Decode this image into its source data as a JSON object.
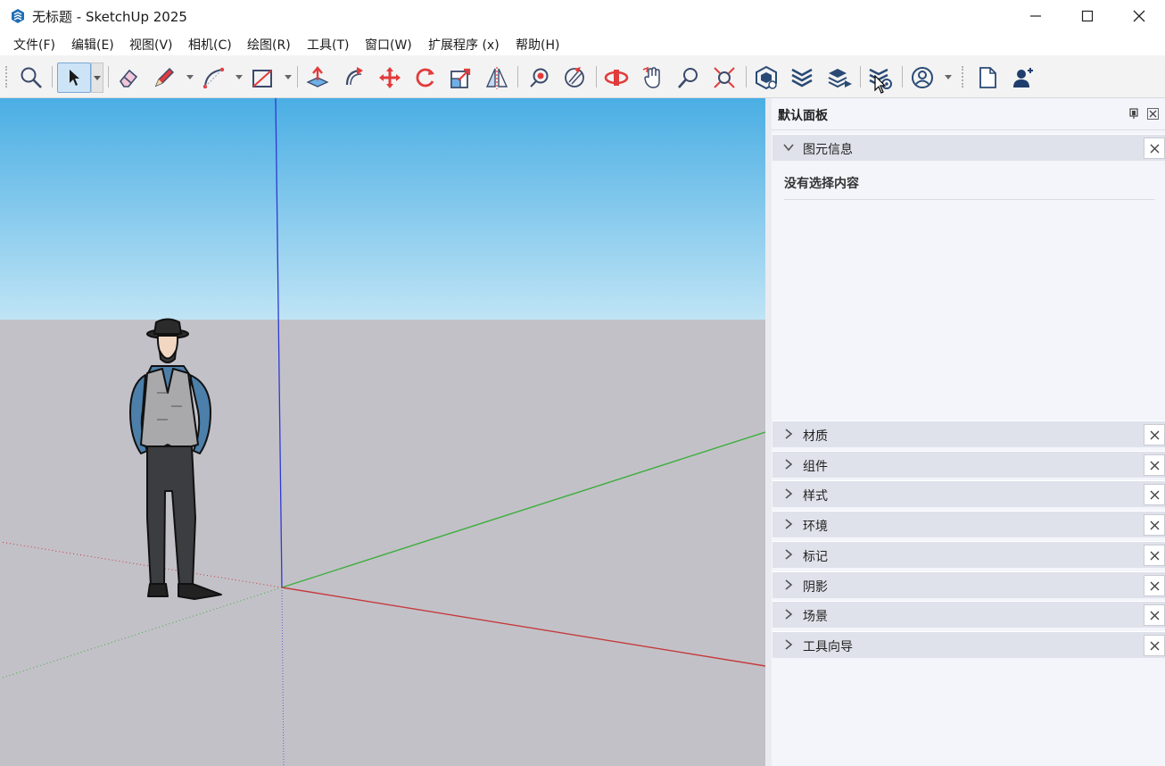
{
  "window": {
    "title": "无标题 - SketchUp 2025",
    "icon": "sketchup-logo-icon",
    "controls": [
      "minimize-icon",
      "maximize-icon",
      "close-icon"
    ]
  },
  "menubar": {
    "items": [
      "文件(F)",
      "编辑(E)",
      "视图(V)",
      "相机(C)",
      "绘图(R)",
      "工具(T)",
      "窗口(W)",
      "扩展程序 (x)",
      "帮助(H)"
    ]
  },
  "toolbar": {
    "tools": [
      "zoom-icon",
      "select-icon",
      "eraser-icon",
      "pencil-icon",
      "arc-icon",
      "rectangle-icon",
      "push-pull-icon",
      "follow-me-icon",
      "move-icon",
      "rotate-icon",
      "scale-icon",
      "flip-icon",
      "paint-bucket-icon",
      "sandbox-icon",
      "orbit-icon",
      "pan-icon",
      "zoom-window-icon",
      "zoom-extents-icon",
      "warehouse-icon",
      "extension-warehouse-icon",
      "layout-icon",
      "extension-manager-icon",
      "account-icon",
      "new-document-icon",
      "add-user-icon"
    ],
    "active_tool": "select-icon"
  },
  "tray": {
    "title": "默认面板",
    "entity_info": {
      "label": "图元信息",
      "empty_text": "没有选择内容"
    },
    "panels": [
      "材质",
      "组件",
      "样式",
      "环境",
      "标记",
      "阴影",
      "场景",
      "工具向导"
    ]
  },
  "colors": {
    "sky_top": "#4aaee4",
    "sky_bottom": "#bfe4f5",
    "ground": "#c3c1c8",
    "axis_red": "#c43a3a",
    "axis_green": "#3cae3c",
    "axis_blue": "#2f3ad0",
    "tray_bg": "#f3f5fb",
    "panel_bg": "#dfe2ea"
  }
}
